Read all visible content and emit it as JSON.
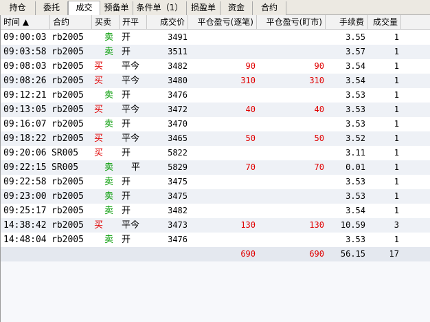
{
  "tabs": [
    {
      "label": "持仓",
      "active": false
    },
    {
      "label": "委托",
      "active": false
    },
    {
      "label": "成交",
      "active": true
    },
    {
      "label": "预备单",
      "active": false
    },
    {
      "label": "条件单（1）",
      "active": false
    },
    {
      "label": "损盈单",
      "active": false
    },
    {
      "label": "资金",
      "active": false
    },
    {
      "label": "合约",
      "active": false
    }
  ],
  "columns": {
    "time": "时间 ▲",
    "contract": "合约",
    "side": "买卖",
    "openclose": "开平",
    "price": "成交价",
    "pnl_trade": "平仓盈亏(逐笔)",
    "pnl_mtm": "平仓盈亏(盯市)",
    "fee": "手续费",
    "qty": "成交量"
  },
  "rows": [
    {
      "time": "09:00:03",
      "contract": "rb2005",
      "side": "卖",
      "openclose": "开",
      "price": "3491",
      "pnl_trade": "",
      "pnl_mtm": "",
      "fee": "3.55",
      "qty": "1"
    },
    {
      "time": "09:03:58",
      "contract": "rb2005",
      "side": "卖",
      "openclose": "开",
      "price": "3511",
      "pnl_trade": "",
      "pnl_mtm": "",
      "fee": "3.57",
      "qty": "1"
    },
    {
      "time": "09:08:03",
      "contract": "rb2005",
      "side": "买",
      "openclose": "平今",
      "price": "3482",
      "pnl_trade": "90",
      "pnl_mtm": "90",
      "fee": "3.54",
      "qty": "1"
    },
    {
      "time": "09:08:26",
      "contract": "rb2005",
      "side": "买",
      "openclose": "平今",
      "price": "3480",
      "pnl_trade": "310",
      "pnl_mtm": "310",
      "fee": "3.54",
      "qty": "1"
    },
    {
      "time": "09:12:21",
      "contract": "rb2005",
      "side": "卖",
      "openclose": "开",
      "price": "3476",
      "pnl_trade": "",
      "pnl_mtm": "",
      "fee": "3.53",
      "qty": "1"
    },
    {
      "time": "09:13:05",
      "contract": "rb2005",
      "side": "买",
      "openclose": "平今",
      "price": "3472",
      "pnl_trade": "40",
      "pnl_mtm": "40",
      "fee": "3.53",
      "qty": "1"
    },
    {
      "time": "09:16:07",
      "contract": "rb2005",
      "side": "卖",
      "openclose": "开",
      "price": "3470",
      "pnl_trade": "",
      "pnl_mtm": "",
      "fee": "3.53",
      "qty": "1"
    },
    {
      "time": "09:18:22",
      "contract": "rb2005",
      "side": "买",
      "openclose": "平今",
      "price": "3465",
      "pnl_trade": "50",
      "pnl_mtm": "50",
      "fee": "3.52",
      "qty": "1"
    },
    {
      "time": "09:20:06",
      "contract": "SR005",
      "side": "买",
      "openclose": "开",
      "price": "5822",
      "pnl_trade": "",
      "pnl_mtm": "",
      "fee": "3.11",
      "qty": "1"
    },
    {
      "time": "09:22:15",
      "contract": "SR005",
      "side": "卖",
      "openclose": "平",
      "price": "5829",
      "pnl_trade": "70",
      "pnl_mtm": "70",
      "fee": "0.01",
      "qty": "1"
    },
    {
      "time": "09:22:58",
      "contract": "rb2005",
      "side": "卖",
      "openclose": "开",
      "price": "3475",
      "pnl_trade": "",
      "pnl_mtm": "",
      "fee": "3.53",
      "qty": "1"
    },
    {
      "time": "09:23:00",
      "contract": "rb2005",
      "side": "卖",
      "openclose": "开",
      "price": "3475",
      "pnl_trade": "",
      "pnl_mtm": "",
      "fee": "3.53",
      "qty": "1"
    },
    {
      "time": "09:25:17",
      "contract": "rb2005",
      "side": "卖",
      "openclose": "开",
      "price": "3482",
      "pnl_trade": "",
      "pnl_mtm": "",
      "fee": "3.54",
      "qty": "1"
    },
    {
      "time": "14:38:42",
      "contract": "rb2005",
      "side": "买",
      "openclose": "平今",
      "price": "3473",
      "pnl_trade": "130",
      "pnl_mtm": "130",
      "fee": "10.59",
      "qty": "3"
    },
    {
      "time": "14:48:04",
      "contract": "rb2005",
      "side": "卖",
      "openclose": "开",
      "price": "3476",
      "pnl_trade": "",
      "pnl_mtm": "",
      "fee": "3.53",
      "qty": "1"
    }
  ],
  "totals": {
    "pnl_trade": "690",
    "pnl_mtm": "690",
    "fee": "56.15",
    "qty": "17"
  },
  "colors": {
    "buy": "#e00000",
    "sell": "#009a00",
    "profit": "#e00000"
  }
}
